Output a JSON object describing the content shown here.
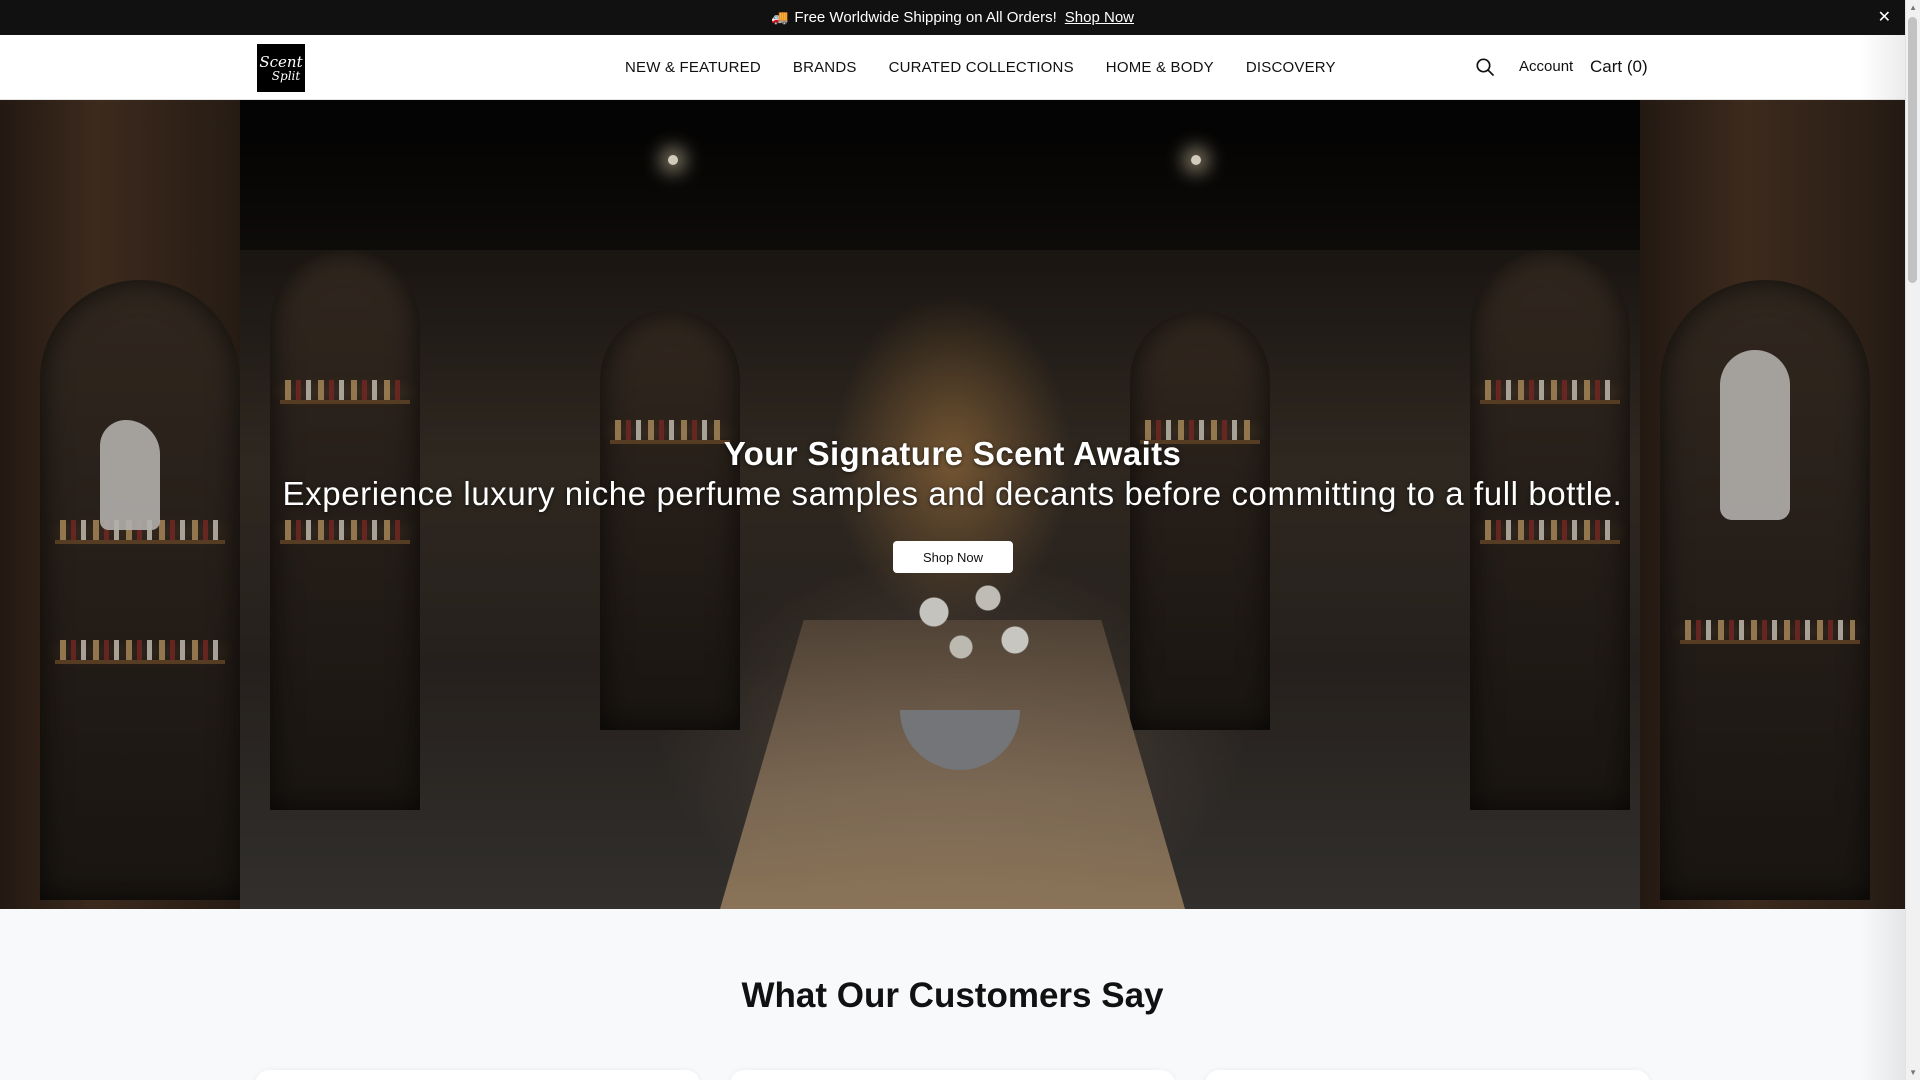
{
  "announcement": {
    "icon": "truck-icon",
    "text": "Free Worldwide Shipping on All Orders!",
    "link": "Shop Now",
    "close": "✕"
  },
  "header": {
    "logo": {
      "line1": "Scent",
      "line2": "Split"
    },
    "nav": [
      "NEW & FEATURED",
      "BRANDS",
      "CURATED COLLECTIONS",
      "HOME & BODY",
      "DISCOVERY"
    ],
    "account": "Account",
    "cart": "Cart (0)"
  },
  "hero": {
    "title": "Your Signature Scent Awaits",
    "subtitle": "Experience luxury niche perfume samples and decants before committing to a full bottle.",
    "button": "Shop Now"
  },
  "testimonials": {
    "title": "What Our Customers Say"
  },
  "colors": {
    "announcement_bg": "#111111",
    "accent": "#ffffff",
    "section_bg": "#f7f9fb"
  }
}
